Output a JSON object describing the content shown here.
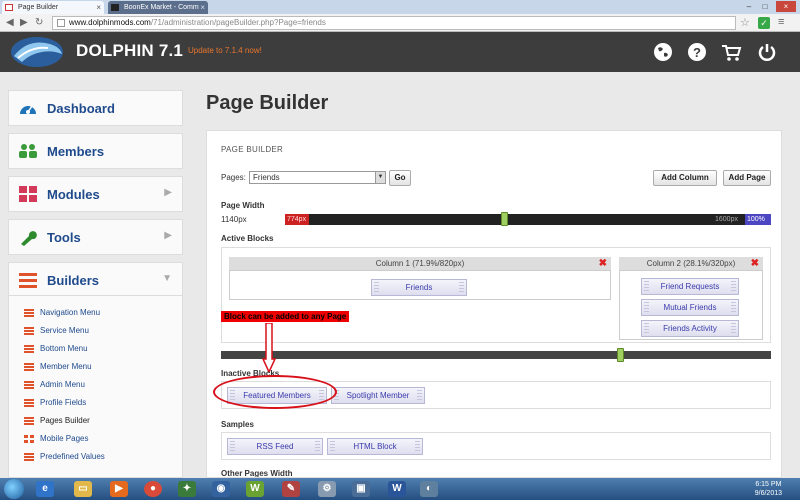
{
  "browser": {
    "tabs": [
      {
        "title": "Page Builder",
        "close": "×"
      },
      {
        "title": "BoonEx Market - Comm",
        "close": "×"
      }
    ],
    "url_host": "www.dolphinmods.com",
    "url_path": "/71/administration/pageBuilder.php?Page=friends",
    "window_controls": [
      "–",
      "□",
      "×"
    ]
  },
  "header": {
    "brand": "DOLPHIN 7.1",
    "update_link": "Update to 7.1.4 now!",
    "icons": [
      "globe-icon",
      "help-icon",
      "cart-icon",
      "power-icon"
    ]
  },
  "sidebar": {
    "items": [
      {
        "label": "Dashboard",
        "icon": "gauge-icon"
      },
      {
        "label": "Members",
        "icon": "users-icon"
      },
      {
        "label": "Modules",
        "icon": "grid-icon"
      },
      {
        "label": "Tools",
        "icon": "wrench-icon"
      },
      {
        "label": "Builders",
        "icon": "list-icon"
      }
    ],
    "sub_items": [
      "Navigation Menu",
      "Service Menu",
      "Bottom Menu",
      "Member Menu",
      "Admin Menu",
      "Profile Fields",
      "Pages Builder",
      "Mobile Pages",
      "Predefined Values"
    ]
  },
  "main": {
    "page_title": "Page Builder",
    "section_title": "PAGE BUILDER",
    "pages_label": "Pages:",
    "pages_selected": "Friends",
    "go_button": "Go",
    "add_column_button": "Add Column",
    "add_page_button": "Add Page",
    "page_width_label": "Page Width",
    "page_width_value": "1140px",
    "slider_min": "774px",
    "slider_max": "1600px",
    "slider_pct": "100%",
    "active_blocks_label": "Active Blocks",
    "column1_title": "Column 1 (71.9%/820px)",
    "column2_title": "Column 2 (28.1%/320px)",
    "column1_blocks": [
      "Friends"
    ],
    "column2_blocks": [
      "Friend Requests",
      "Mutual Friends",
      "Friends Activity"
    ],
    "annotation": "Block can be added to any Page",
    "inactive_blocks_label": "Inactive Blocks",
    "inactive_blocks": [
      "Featured Members",
      "Spotlight Member"
    ],
    "samples_label": "Samples",
    "samples": [
      "RSS Feed",
      "HTML Block"
    ],
    "other_pages_width_label": "Other Pages Width"
  },
  "taskbar": {
    "time": "6:15 PM",
    "date": "9/6/2013"
  },
  "colors": {
    "header_bg": "#3d3d3d",
    "link_blue": "#1f4a8c",
    "update_orange": "#e8762d",
    "annotation_red": "#e00000"
  }
}
